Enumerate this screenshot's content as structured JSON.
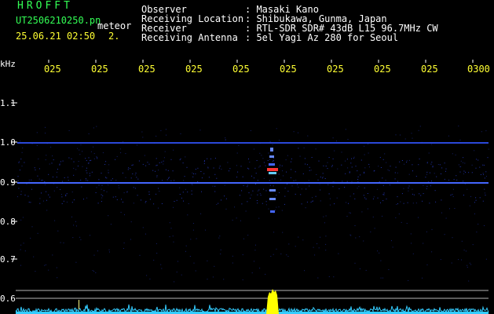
{
  "header": {
    "app_title": "HROFFT",
    "file_name": "UT2506210250.pn",
    "meteor_label": "meteor",
    "datetime": "25.06.21 02:50",
    "meteor_count": "2.",
    "info": [
      {
        "label": "Observer",
        "value": ": Masaki Kano"
      },
      {
        "label": "Receiving Location",
        "value": ": Shibukawa, Gunma, Japan"
      },
      {
        "label": "Receiver",
        "value": ": RTL-SDR SDR# 43dB L15 96.7MHz CW"
      },
      {
        "label": "Receiving Antenna",
        "value": ": 5el Yagi Az 280 for Seoul"
      }
    ]
  },
  "axis": {
    "unit": "kHz",
    "x_ticks": [
      "025",
      "025",
      "025",
      "025",
      "025",
      "025",
      "025",
      "025",
      "025",
      "0300"
    ],
    "y_ticks": [
      "1.1",
      "1.0",
      "0.9",
      "0.8",
      "0.7",
      "0.6"
    ]
  },
  "colors": {
    "background": "#000000",
    "grid": "#ffffff",
    "title": "#33ff55",
    "ticks": "#ffff33",
    "signal_band": "#3355ff",
    "meteor_echo": "#ff3333",
    "baseline_trace": "#33ccff",
    "baseline_spike": "#ffff00"
  }
}
